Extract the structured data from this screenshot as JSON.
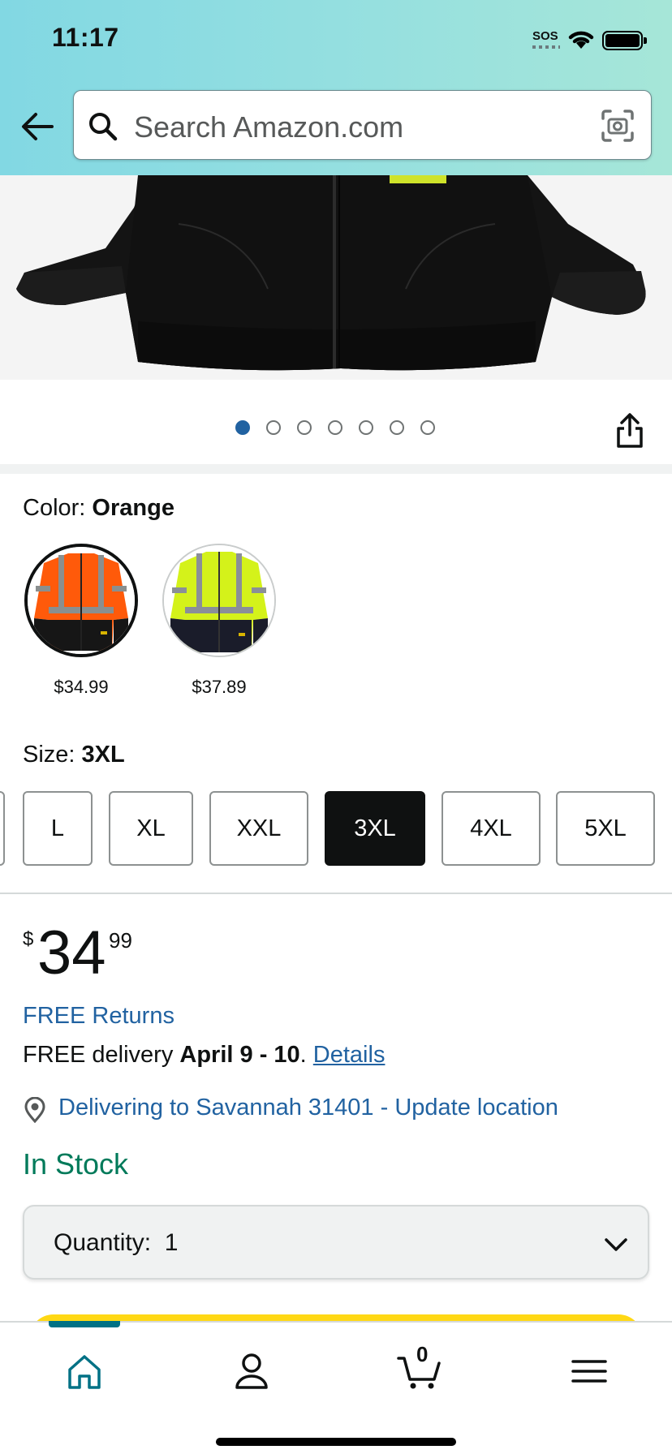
{
  "status_bar": {
    "time": "11:17",
    "sos": "SOS"
  },
  "search": {
    "placeholder": "Search Amazon.com"
  },
  "carousel": {
    "total_images": 7,
    "active_index": 0
  },
  "color": {
    "label": "Color:",
    "selected": "Orange",
    "options": [
      {
        "name": "Orange",
        "price": "$34.99",
        "selected": true
      },
      {
        "name": "Yellow",
        "price": "$37.89",
        "selected": false
      }
    ]
  },
  "size": {
    "label": "Size:",
    "selected": "3XL",
    "options": [
      "L",
      "XL",
      "XXL",
      "3XL",
      "4XL",
      "5XL"
    ]
  },
  "price": {
    "symbol": "$",
    "whole": "34",
    "fraction": "99"
  },
  "returns": "FREE Returns",
  "delivery": {
    "prefix": "FREE delivery",
    "dates": "April 9 - 10",
    "separator": ".",
    "details_link": "Details"
  },
  "location": "Delivering to Savannah 31401 - Update location",
  "stock": "In Stock",
  "quantity": {
    "label": "Quantity:",
    "value": "1"
  },
  "bottom_nav": {
    "cart_count": "0"
  },
  "colors": {
    "link": "#2162a1",
    "in_stock": "#007a5a",
    "nav_active": "#007185",
    "buy_button": "#ffd814"
  }
}
